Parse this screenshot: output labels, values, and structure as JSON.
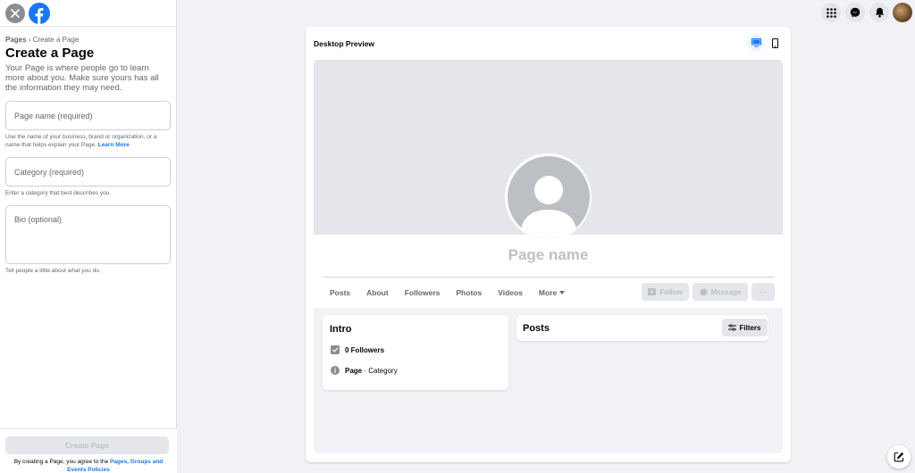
{
  "sidebar": {
    "breadcrumb": {
      "root": "Pages",
      "separator": "›",
      "current": "Create a Page"
    },
    "title": "Create a Page",
    "description": "Your Page is where people go to learn more about you. Make sure yours has all the information they may need.",
    "page_name": {
      "placeholder": "Page name (required)",
      "hint": "Use the name of your business, brand or organization, or a name that helps explain your Page.",
      "hint_link": "Learn More"
    },
    "category": {
      "placeholder": "Category (required)",
      "hint": "Enter a category that best describes you."
    },
    "bio": {
      "placeholder": "Bio (optional)",
      "hint": "Tell people a little about what you do."
    },
    "create_button": "Create Page",
    "terms_prefix": "By creating a Page, you agree to the",
    "terms_link": "Pages, Groups and Events Policies"
  },
  "preview": {
    "title": "Desktop Preview",
    "page_name": "Page name",
    "tabs": [
      "Posts",
      "About",
      "Followers",
      "Photos",
      "Videos",
      "More"
    ],
    "follow": "Follow",
    "message": "Message",
    "more_actions": "···",
    "intro": {
      "title": "Intro",
      "followers": "0 Followers",
      "page_label": "Page",
      "category_suffix": " · Category"
    },
    "posts": {
      "title": "Posts",
      "filters": "Filters"
    }
  },
  "colors": {
    "accent": "#1877f2",
    "background": "#f0f2f5",
    "disabled": "#bcc0c4"
  }
}
